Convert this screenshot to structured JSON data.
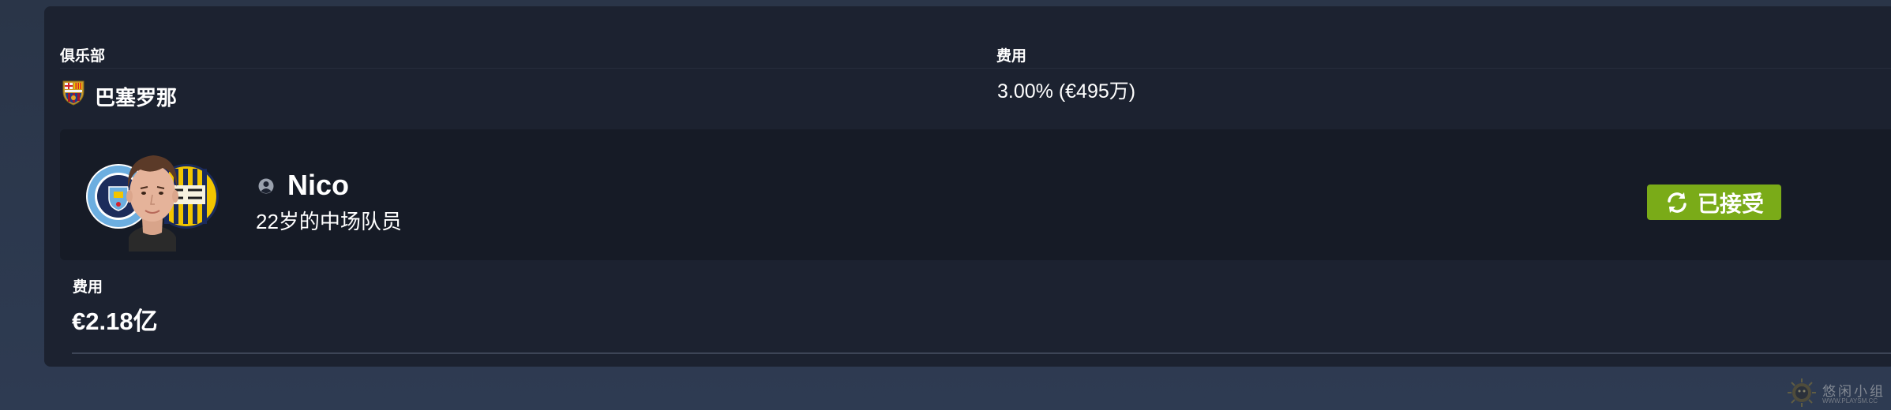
{
  "club_section": {
    "label": "俱乐部",
    "club_name": "巴塞罗那",
    "crest_icon": "fc-barcelona-crest-icon"
  },
  "fee_section": {
    "label": "费用",
    "value": "3.00% (€495万)"
  },
  "player": {
    "name": "Nico",
    "description": "22岁的中场队员",
    "avatar_icon": "player-photo-with-club-badges",
    "person_icon": "person-icon"
  },
  "status": {
    "label": "已接受",
    "icon": "refresh-icon",
    "color": "#7aab18"
  },
  "total_fee": {
    "label": "费用",
    "value": "€2.18亿"
  },
  "watermark": {
    "title": "悠闲小组",
    "url": "WWW.PLAYSM.CC"
  },
  "colors": {
    "panel_bg": "#1c2230",
    "card_bg": "#161b26",
    "page_bg": "#2a3548",
    "accent_green": "#7aab18"
  }
}
